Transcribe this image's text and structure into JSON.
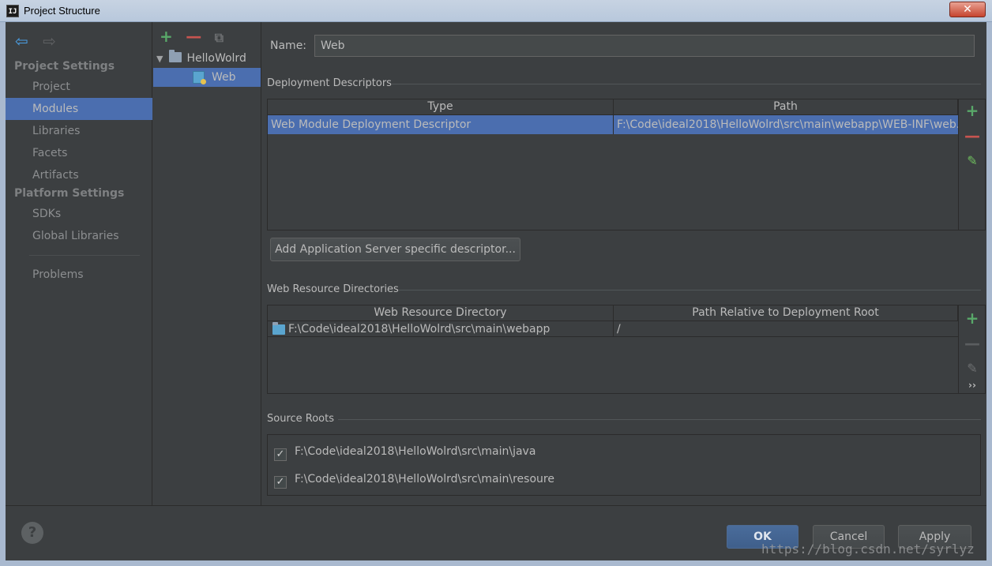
{
  "window": {
    "title": "Project Structure",
    "app_icon_text": "IJ",
    "close_label": "✕"
  },
  "nav": {
    "back_icon": "arrow-left-icon",
    "forward_icon": "arrow-right-icon",
    "project_settings_header": "Project Settings",
    "platform_settings_header": "Platform Settings",
    "items": {
      "project": "Project",
      "modules": "Modules",
      "libraries": "Libraries",
      "facets": "Facets",
      "artifacts": "Artifacts",
      "sdks": "SDKs",
      "global_libraries": "Global Libraries",
      "problems": "Problems"
    },
    "selected": "Modules"
  },
  "tree": {
    "toolbar": {
      "add": "+",
      "remove": "—",
      "copy": "⧉"
    },
    "root": "HelloWolrd",
    "child": "Web"
  },
  "main": {
    "name_label": "Name:",
    "name_value": "Web",
    "deployment": {
      "title": "Deployment Descriptors",
      "columns": [
        "Type",
        "Path"
      ],
      "rows": [
        {
          "type": "Web Module Deployment Descriptor",
          "path": "F:\\Code\\ideal2018\\HelloWolrd\\src\\main\\webapp\\WEB-INF\\web."
        }
      ],
      "add_server_button": "Add Application Server specific descriptor..."
    },
    "resources": {
      "title": "Web Resource Directories",
      "columns": [
        "Web Resource Directory",
        "Path Relative to Deployment Root"
      ],
      "rows": [
        {
          "dir": "F:\\Code\\ideal2018\\HelloWolrd\\src\\main\\webapp",
          "rel": "/"
        }
      ]
    },
    "source_roots": {
      "title": "Source Roots",
      "items": [
        {
          "path": "F:\\Code\\ideal2018\\HelloWolrd\\src\\main\\java",
          "checked": true
        },
        {
          "path": "F:\\Code\\ideal2018\\HelloWolrd\\src\\main\\resoure",
          "checked": true
        }
      ]
    },
    "side_tools": {
      "add": "+",
      "remove": "—",
      "edit": "✎",
      "more": "››"
    }
  },
  "footer": {
    "help": "?",
    "ok": "OK",
    "cancel": "Cancel",
    "apply": "Apply",
    "watermark": "https://blog.csdn.net/syrlyz"
  },
  "colors": {
    "selection": "#4b6eaf",
    "background": "#3c3f41",
    "add": "#59a869",
    "remove": "#c75450"
  }
}
